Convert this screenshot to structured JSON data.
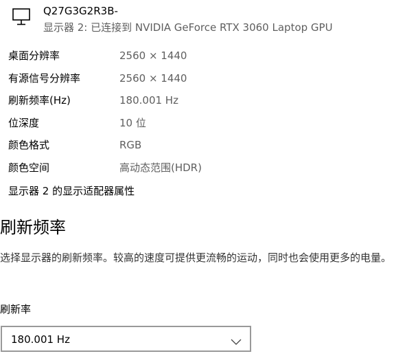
{
  "monitor": {
    "icon": "monitor-icon",
    "name": "Q27G3G2R3B-",
    "subtitle": "显示器 2: 已连接到 NVIDIA GeForce RTX 3060 Laptop GPU"
  },
  "properties": [
    {
      "label": "桌面分辨率",
      "value": "2560 × 1440"
    },
    {
      "label": "有源信号分辨率",
      "value": "2560 × 1440"
    },
    {
      "label": "刷新频率(Hz)",
      "value": "180.001 Hz"
    },
    {
      "label": "位深度",
      "value": "10 位"
    },
    {
      "label": "颜色格式",
      "value": "RGB"
    },
    {
      "label": "颜色空间",
      "value": "高动态范围(HDR)"
    }
  ],
  "adapter_link": "显示器 2 的显示适配器属性",
  "refresh_section": {
    "title": "刷新频率",
    "description": "选择显示器的刷新频率。较高的速度可提供更流畅的运动，同时也会使用更多的电量。",
    "rate_label": "刷新率",
    "selected_rate": "180.001 Hz",
    "dropdown_icon": "chevron-down-icon"
  },
  "colors": {
    "text_primary": "#000000",
    "text_secondary": "#5f5f5f",
    "border": "#999999"
  }
}
